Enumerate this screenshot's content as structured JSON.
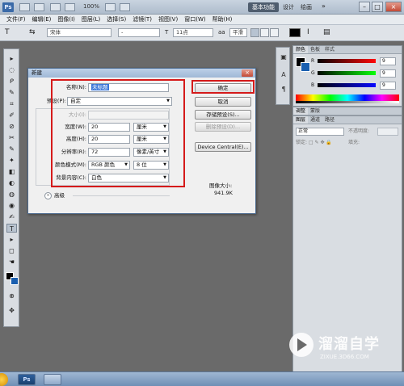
{
  "titlebar": {
    "logo": "Ps",
    "zoom": "100%",
    "workspace": "基本功能",
    "links": [
      "设计",
      "绘画"
    ],
    "more": "»",
    "min": "–",
    "max": "□",
    "close": "×"
  },
  "menu": [
    "文件(F)",
    "编辑(E)",
    "图像(I)",
    "图层(L)",
    "选择(S)",
    "滤镜(T)",
    "视图(V)",
    "窗口(W)",
    "帮助(H)"
  ],
  "options": {
    "tool_icon": "T",
    "orient_icon": "⇆",
    "font_family": "宋体",
    "font_style": "-",
    "size_icon": "T",
    "font_size": "11点",
    "aa_icon": "aa",
    "antialias": "平滑",
    "warp_icon": "Ⅰ",
    "panel_icon": "▤"
  },
  "tools": [
    "▸",
    "◌",
    "ᑭ",
    "✎",
    "⌗",
    "✐",
    "⊘",
    "✂",
    "✎",
    "✦",
    "◧",
    "◐",
    "◍",
    "◉",
    "✍",
    "T",
    "▸",
    "◻",
    "☚",
    "⊕",
    "✥"
  ],
  "panel_icons": [
    "▣",
    "A",
    "¶"
  ],
  "color_panel": {
    "tabs": [
      "颜色",
      "色板",
      "样式"
    ],
    "r_label": "R",
    "g_label": "G",
    "b_label": "B",
    "r": "9",
    "g": "9",
    "b": "9"
  },
  "layers_panel": {
    "top_tabs": [
      "调整",
      "蒙版"
    ],
    "tabs": [
      "图层",
      "通道",
      "路径"
    ],
    "blend_mode": "正常",
    "opacity_label": "不透明度:",
    "lock_label": "锁定:",
    "lock_icons": "□ ✎ ✥ 🔒",
    "fill_label": "填充:"
  },
  "dialog": {
    "title": "新建",
    "close": "×",
    "name_label": "名称(N):",
    "name_value": "未标题",
    "preset_label": "预设(P):",
    "preset_value": "自定",
    "size_label": "大小(I):",
    "width_label": "宽度(W):",
    "width_value": "20",
    "width_unit": "厘米",
    "height_label": "高度(H):",
    "height_value": "20",
    "height_unit": "厘米",
    "resolution_label": "分辨率(R):",
    "resolution_value": "72",
    "resolution_unit": "像素/英寸",
    "color_mode_label": "颜色模式(M):",
    "color_mode_value": "RGB 颜色",
    "bit_depth": "8 位",
    "background_label": "背景内容(C):",
    "background_value": "白色",
    "advanced_label": "高级",
    "ok": "确定",
    "cancel": "取消",
    "save_preset": "存储预设(S)...",
    "delete_preset": "删除预设(D)...",
    "device_central": "Device Central(E)...",
    "image_size_label": "图像大小:",
    "image_size_value": "941.9K",
    "dropdown_arrow": "▼"
  },
  "taskbar": {
    "ps_label": "Ps"
  },
  "watermark": {
    "brand": "溜溜自学",
    "url": "ZIXUE.3D66.COM"
  },
  "colors": {
    "highlight_box": "#d51a1a",
    "foreground": "#000000",
    "background_color": "#1a5fb0"
  }
}
